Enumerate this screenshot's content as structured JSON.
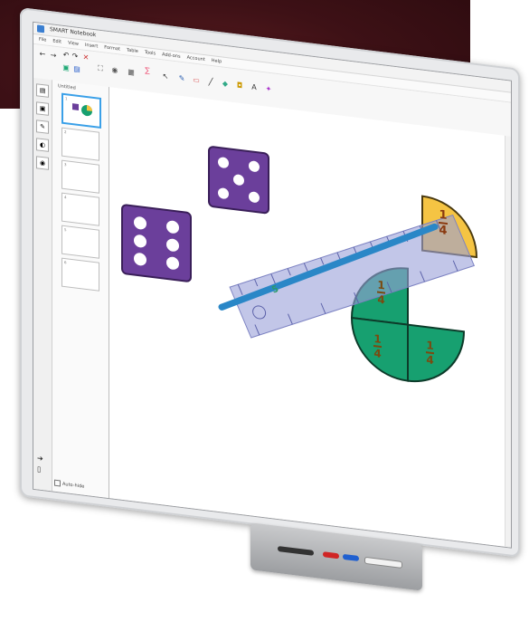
{
  "window": {
    "title": "SMART Notebook"
  },
  "menu": {
    "items": [
      "File",
      "Edit",
      "View",
      "Insert",
      "Format",
      "Table",
      "Tools",
      "Add-ons",
      "Account",
      "Help"
    ]
  },
  "toolbar": {
    "icons": [
      "back-icon",
      "forward-icon",
      "add-page-icon",
      "undo-icon",
      "redo-icon",
      "delete-icon",
      "screen-shade-icon",
      "fullscreen-icon",
      "document-camera-icon",
      "table-icon",
      "math-icon",
      "select-icon",
      "pen-icon",
      "eraser-icon",
      "line-icon",
      "shape-icon",
      "fill-icon",
      "text-icon",
      "magic-pen-icon"
    ]
  },
  "sorter": {
    "title": "Untitled",
    "thumbs": [
      "1",
      "2",
      "3",
      "4",
      "5",
      "6"
    ]
  },
  "autohide": {
    "label": "Auto-hide"
  },
  "canvas": {
    "dice": [
      {
        "pips": 5
      },
      {
        "pips": 6
      }
    ],
    "fractions": [
      {
        "num": "1",
        "den": "4",
        "color": "#f5c443"
      },
      {
        "num": "1",
        "den": "4",
        "color": "#17a070"
      },
      {
        "num": "1",
        "den": "4",
        "color": "#17a070"
      },
      {
        "num": "1",
        "den": "4",
        "color": "#17a070"
      }
    ],
    "ruler_number": "5",
    "colors": {
      "die": "#6b3f9b",
      "ruler": "#9aa0d8",
      "line": "#2a87c7"
    }
  }
}
